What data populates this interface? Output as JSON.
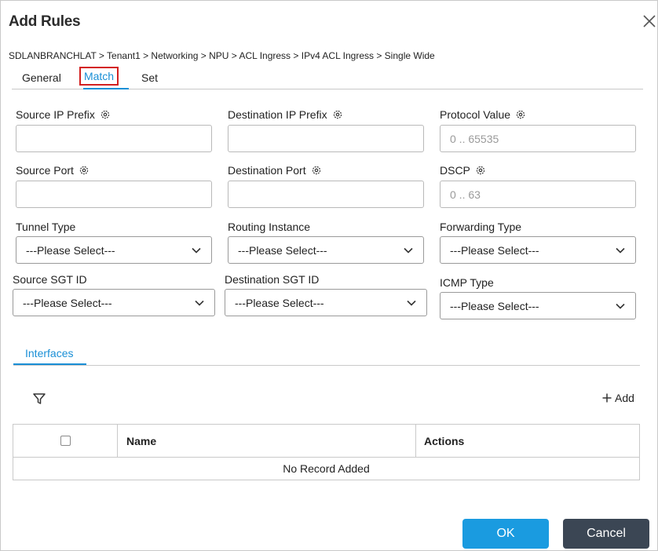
{
  "dialog": {
    "title": "Add Rules"
  },
  "breadcrumb": "SDLANBRANCHLAT > Tenant1 > Networking > NPU > ACL Ingress > IPv4 ACL Ingress > Single Wide",
  "tabs": [
    {
      "label": "General",
      "active": false
    },
    {
      "label": "Match",
      "active": true
    },
    {
      "label": "Set",
      "active": false
    }
  ],
  "fields": {
    "source_ip_prefix": {
      "label": "Source IP Prefix",
      "value": "",
      "placeholder": ""
    },
    "destination_ip_prefix": {
      "label": "Destination IP Prefix",
      "value": "",
      "placeholder": ""
    },
    "protocol_value": {
      "label": "Protocol Value",
      "value": "",
      "placeholder": "0 .. 65535"
    },
    "source_port": {
      "label": "Source Port",
      "value": "",
      "placeholder": ""
    },
    "destination_port": {
      "label": "Destination Port",
      "value": "",
      "placeholder": ""
    },
    "dscp": {
      "label": "DSCP",
      "value": "",
      "placeholder": "0 .. 63"
    },
    "tunnel_type": {
      "label": "Tunnel Type",
      "selected": "---Please Select---"
    },
    "routing_instance": {
      "label": "Routing Instance",
      "selected": "---Please Select---"
    },
    "forwarding_type": {
      "label": "Forwarding Type",
      "selected": "---Please Select---"
    },
    "source_sgt_id": {
      "label": "Source SGT ID",
      "selected": "---Please Select---"
    },
    "destination_sgt_id": {
      "label": "Destination SGT ID",
      "selected": "---Please Select---"
    },
    "icmp_type": {
      "label": "ICMP Type",
      "selected": "---Please Select---"
    }
  },
  "subtab": {
    "label": "Interfaces"
  },
  "toolbar": {
    "add_label": "Add",
    "filter_icon": "filter-icon",
    "add_icon": "plus-icon"
  },
  "table": {
    "columns": [
      "Name",
      "Actions"
    ],
    "empty_text": "No Record Added"
  },
  "footer": {
    "ok_label": "OK",
    "cancel_label": "Cancel"
  },
  "colors": {
    "accent": "#1a9be0",
    "highlight_box": "#d32020",
    "cancel_bg": "#3b4654"
  }
}
